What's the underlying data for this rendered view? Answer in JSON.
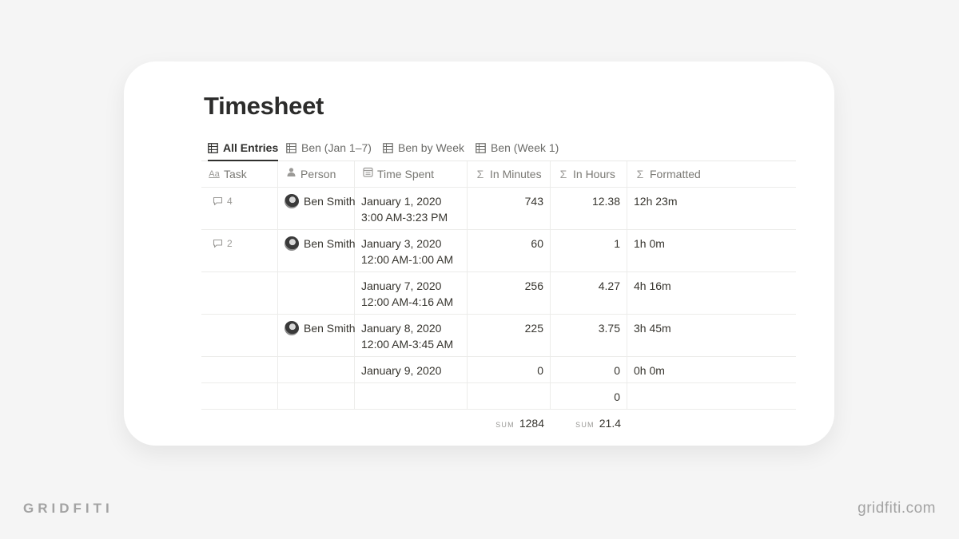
{
  "page": {
    "title": "Timesheet"
  },
  "tabs": [
    {
      "label": "All Entries",
      "active": true,
      "icon": "table-icon"
    },
    {
      "label": "Ben (Jan 1–7)",
      "active": false,
      "icon": "table-icon"
    },
    {
      "label": "Ben by Week",
      "active": false,
      "icon": "table-icon"
    },
    {
      "label": "Ben (Week 1)",
      "active": false,
      "icon": "table-icon"
    }
  ],
  "columns": [
    {
      "label": "Task",
      "icon": "text-aa-icon"
    },
    {
      "label": "Person",
      "icon": "person-icon"
    },
    {
      "label": "Time Spent",
      "icon": "calendar-icon"
    },
    {
      "label": "In Minutes",
      "icon": "sigma-icon"
    },
    {
      "label": "In Hours",
      "icon": "sigma-icon"
    },
    {
      "label": "Formatted",
      "icon": "sigma-icon"
    }
  ],
  "rows": [
    {
      "comments": "4",
      "person": "Ben Smith",
      "date": "January 1, 2020",
      "range": "3:00 AM‑3:23 PM",
      "minutes": "743",
      "hours": "12.38",
      "formatted": "12h 23m"
    },
    {
      "comments": "2",
      "person": "Ben Smith",
      "date": "January 3, 2020",
      "range": "12:00 AM‑1:00 AM",
      "minutes": "60",
      "hours": "1",
      "formatted": "1h 0m"
    },
    {
      "comments": "",
      "person": "",
      "date": "January 7, 2020",
      "range": "12:00 AM‑4:16 AM",
      "minutes": "256",
      "hours": "4.27",
      "formatted": "4h 16m"
    },
    {
      "comments": "",
      "person": "Ben Smith",
      "date": "January 8, 2020",
      "range": "12:00 AM‑3:45 AM",
      "minutes": "225",
      "hours": "3.75",
      "formatted": "3h 45m"
    },
    {
      "comments": "",
      "person": "",
      "date": "January 9, 2020",
      "range": "",
      "minutes": "0",
      "hours": "0",
      "formatted": "0h 0m"
    },
    {
      "comments": "",
      "person": "",
      "date": "",
      "range": "",
      "minutes": "",
      "hours": "0",
      "formatted": ""
    }
  ],
  "summary": {
    "label": "SUM",
    "minutes": "1284",
    "hours": "21.4"
  },
  "branding": {
    "left": "GRIDFITI",
    "right": "gridfiti.com"
  },
  "colors": {
    "background": "#f5f5f5",
    "card": "#ffffff",
    "text": "#37352f",
    "muted": "#9b9a97",
    "border": "#ececea"
  }
}
